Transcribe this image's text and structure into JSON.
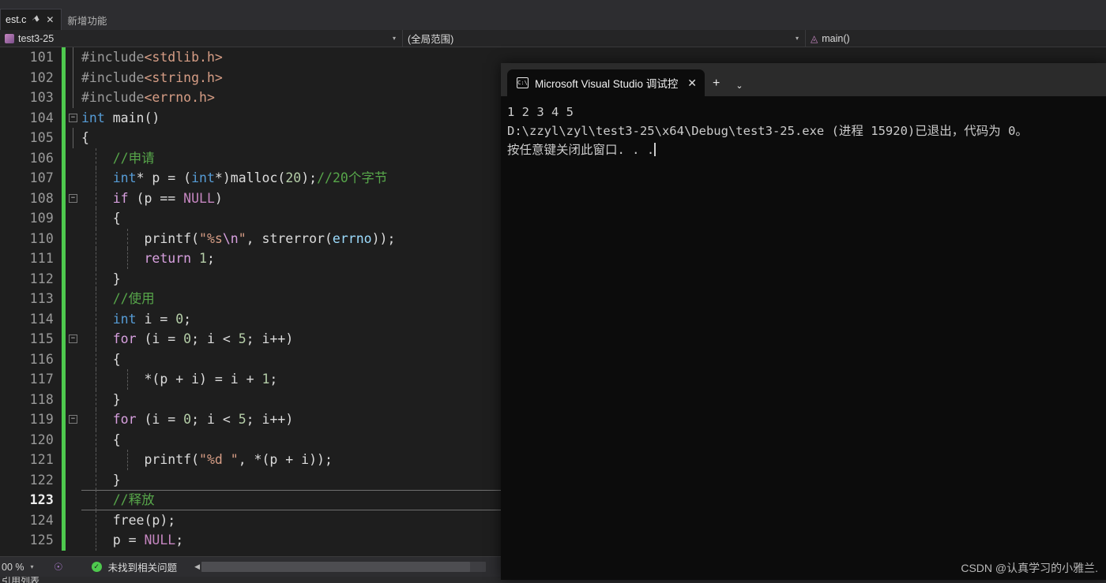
{
  "tabs": [
    {
      "label": "est.c",
      "pin": "⚑",
      "close": "✕",
      "state": "active"
    },
    {
      "label": "新增功能",
      "state": "inactive"
    }
  ],
  "navbar": {
    "project": "test3-25",
    "scope": "(全局范围)",
    "member": "main()",
    "caret": "▾"
  },
  "editor": {
    "lines": [
      {
        "num": "101",
        "fold": "",
        "guide": "bar",
        "tokens": [
          {
            "t": "#include",
            "c": "k-pre"
          },
          {
            "t": "<stdlib.h>",
            "c": "k-hdr"
          }
        ]
      },
      {
        "num": "102",
        "fold": "",
        "guide": "bar",
        "tokens": [
          {
            "t": "#include",
            "c": "k-pre"
          },
          {
            "t": "<string.h>",
            "c": "k-hdr"
          }
        ]
      },
      {
        "num": "103",
        "fold": "",
        "guide": "bar",
        "tokens": [
          {
            "t": "#include",
            "c": "k-pre"
          },
          {
            "t": "<errno.h>",
            "c": "k-hdr"
          }
        ]
      },
      {
        "num": "104",
        "fold": "minus",
        "guide": "none",
        "tokens": [
          {
            "t": "int",
            "c": "k-type"
          },
          {
            "t": " main()",
            "c": "k-plain"
          }
        ]
      },
      {
        "num": "105",
        "fold": "",
        "guide": "line",
        "tokens": [
          {
            "t": "{",
            "c": "k-punc"
          }
        ]
      },
      {
        "num": "106",
        "fold": "",
        "guide": "dash",
        "tokens": [
          {
            "t": "    //申请",
            "c": "k-cmt"
          }
        ]
      },
      {
        "num": "107",
        "fold": "",
        "guide": "dash",
        "tokens": [
          {
            "t": "    ",
            "c": "k-plain"
          },
          {
            "t": "int",
            "c": "k-type"
          },
          {
            "t": "* p = (",
            "c": "k-plain"
          },
          {
            "t": "int",
            "c": "k-type"
          },
          {
            "t": "*)malloc(",
            "c": "k-plain"
          },
          {
            "t": "20",
            "c": "k-num"
          },
          {
            "t": ");",
            "c": "k-plain"
          },
          {
            "t": "//20个字节",
            "c": "k-cmt"
          }
        ]
      },
      {
        "num": "108",
        "fold": "minus",
        "guide": "dash",
        "tokens": [
          {
            "t": "    ",
            "c": "k-plain"
          },
          {
            "t": "if",
            "c": "k-kw"
          },
          {
            "t": " (p == ",
            "c": "k-plain"
          },
          {
            "t": "NULL",
            "c": "k-mac"
          },
          {
            "t": ")",
            "c": "k-plain"
          }
        ]
      },
      {
        "num": "109",
        "fold": "",
        "guide": "dash",
        "tokens": [
          {
            "t": "    {",
            "c": "k-punc"
          }
        ]
      },
      {
        "num": "110",
        "fold": "",
        "guide": "dash2",
        "tokens": [
          {
            "t": "        printf(",
            "c": "k-plain"
          },
          {
            "t": "\"%s",
            "c": "k-str"
          },
          {
            "t": "\\n",
            "c": "k-esc"
          },
          {
            "t": "\"",
            "c": "k-str"
          },
          {
            "t": ", strerror(",
            "c": "k-plain"
          },
          {
            "t": "errno",
            "c": "k-var"
          },
          {
            "t": "));",
            "c": "k-plain"
          }
        ]
      },
      {
        "num": "111",
        "fold": "",
        "guide": "dash2",
        "tokens": [
          {
            "t": "        ",
            "c": "k-plain"
          },
          {
            "t": "return",
            "c": "k-kw"
          },
          {
            "t": " ",
            "c": "k-plain"
          },
          {
            "t": "1",
            "c": "k-num"
          },
          {
            "t": ";",
            "c": "k-plain"
          }
        ]
      },
      {
        "num": "112",
        "fold": "",
        "guide": "dash",
        "tokens": [
          {
            "t": "    }",
            "c": "k-punc"
          }
        ]
      },
      {
        "num": "113",
        "fold": "",
        "guide": "dash",
        "tokens": [
          {
            "t": "    //使用",
            "c": "k-cmt"
          }
        ]
      },
      {
        "num": "114",
        "fold": "",
        "guide": "dash",
        "tokens": [
          {
            "t": "    ",
            "c": "k-plain"
          },
          {
            "t": "int",
            "c": "k-type"
          },
          {
            "t": " i = ",
            "c": "k-plain"
          },
          {
            "t": "0",
            "c": "k-num"
          },
          {
            "t": ";",
            "c": "k-plain"
          }
        ]
      },
      {
        "num": "115",
        "fold": "minus",
        "guide": "dash",
        "tokens": [
          {
            "t": "    ",
            "c": "k-plain"
          },
          {
            "t": "for",
            "c": "k-kw"
          },
          {
            "t": " (i = ",
            "c": "k-plain"
          },
          {
            "t": "0",
            "c": "k-num"
          },
          {
            "t": "; i < ",
            "c": "k-plain"
          },
          {
            "t": "5",
            "c": "k-num"
          },
          {
            "t": "; i++)",
            "c": "k-plain"
          }
        ]
      },
      {
        "num": "116",
        "fold": "",
        "guide": "dash",
        "tokens": [
          {
            "t": "    {",
            "c": "k-punc"
          }
        ]
      },
      {
        "num": "117",
        "fold": "",
        "guide": "dash2",
        "tokens": [
          {
            "t": "        *(p + i) = i + ",
            "c": "k-plain"
          },
          {
            "t": "1",
            "c": "k-num"
          },
          {
            "t": ";",
            "c": "k-plain"
          }
        ]
      },
      {
        "num": "118",
        "fold": "",
        "guide": "dash",
        "tokens": [
          {
            "t": "    }",
            "c": "k-punc"
          }
        ]
      },
      {
        "num": "119",
        "fold": "minus",
        "guide": "dash",
        "tokens": [
          {
            "t": "    ",
            "c": "k-plain"
          },
          {
            "t": "for",
            "c": "k-kw"
          },
          {
            "t": " (i = ",
            "c": "k-plain"
          },
          {
            "t": "0",
            "c": "k-num"
          },
          {
            "t": "; i < ",
            "c": "k-plain"
          },
          {
            "t": "5",
            "c": "k-num"
          },
          {
            "t": "; i++)",
            "c": "k-plain"
          }
        ]
      },
      {
        "num": "120",
        "fold": "",
        "guide": "dash",
        "tokens": [
          {
            "t": "    {",
            "c": "k-punc"
          }
        ]
      },
      {
        "num": "121",
        "fold": "",
        "guide": "dash2",
        "tokens": [
          {
            "t": "        printf(",
            "c": "k-plain"
          },
          {
            "t": "\"%d \"",
            "c": "k-str"
          },
          {
            "t": ", *(p + i));",
            "c": "k-plain"
          }
        ]
      },
      {
        "num": "122",
        "fold": "",
        "guide": "dash",
        "tokens": [
          {
            "t": "    }",
            "c": "k-punc"
          }
        ]
      },
      {
        "num": "123",
        "fold": "",
        "guide": "dash",
        "current": true,
        "tokens": [
          {
            "t": "    //释放",
            "c": "k-cmt"
          }
        ]
      },
      {
        "num": "124",
        "fold": "",
        "guide": "dash",
        "tokens": [
          {
            "t": "    free(p);",
            "c": "k-plain"
          }
        ]
      },
      {
        "num": "125",
        "fold": "",
        "guide": "dash",
        "tokens": [
          {
            "t": "    p = ",
            "c": "k-plain"
          },
          {
            "t": "NULL",
            "c": "k-mac"
          },
          {
            "t": ";",
            "c": "k-plain"
          }
        ]
      }
    ]
  },
  "statusbar": {
    "zoom": "00 %",
    "caret": "▾",
    "problems_icon": "✓",
    "problems_text": "未找到相关问题",
    "scroll_left_arrow": "◀"
  },
  "bottom_clip": "引用列表",
  "console": {
    "tab_icon_text": "C:\\",
    "tab_title": "Microsoft Visual Studio 调试控",
    "tab_close": "✕",
    "new_tab": "+",
    "dropdown": "⌄",
    "output": [
      "1 2 3 4 5",
      "D:\\zzyl\\zyl\\test3-25\\x64\\Debug\\test3-25.exe (进程 15920)已退出，代码为 0。",
      "按任意键关闭此窗口. . ."
    ]
  },
  "watermark": "CSDN @认真学习的小雅兰."
}
